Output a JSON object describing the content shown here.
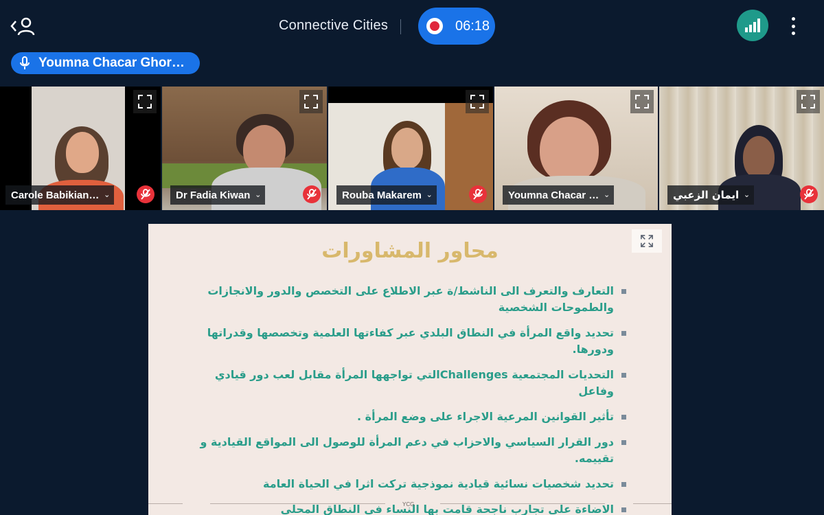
{
  "header": {
    "meeting_title": "Connective Cities",
    "recording_time": "06:18",
    "active_speaker": "Youmna Chacar Ghor…"
  },
  "participants": [
    {
      "name": "Carole Babikian…",
      "muted": true
    },
    {
      "name": "Dr Fadia Kiwan",
      "muted": true
    },
    {
      "name": "Rouba Makarem",
      "muted": true
    },
    {
      "name": "Youmna Chacar …",
      "muted": false,
      "active": true
    },
    {
      "name": "ايمان الزعبي",
      "muted": true
    }
  ],
  "slide": {
    "title": "محاور المشاورات",
    "bullets": [
      "التعارف والتعرف الى الناشط/ة عبر الاطلاع على التخصص والدور والانجازات والطموحات الشخصية",
      "تحديد واقع المرأة في النطاق البلدي عبر كفاءتها العلمية وتخصصها وقدراتها ودورها.",
      "التحديات المجتمعية Challengesالتي تواجهها المرأة مقابل لعب دور قيادي وفاعل",
      "تأثير القوانين المرعية الاجراء على وضع المرأة .",
      "دور القرار السياسي والاحزاب في دعم المرأة للوصول الى المواقع القيادية و تقييمه.",
      "تحديد شخصيات نسائية قيادية نموذجية تركت اثرا في الحياة العامة",
      "الاضاءة على تجارب ناجحة قامت بها النساء في النطاق المحلي"
    ],
    "footer": "YCG"
  },
  "colors": {
    "background": "#0b1a2e",
    "accent_blue": "#1a73e8",
    "signal_teal": "#1f9a8a",
    "mute_red": "#e8323a",
    "slide_title": "#d8b86c",
    "slide_text": "#2a9d8a"
  },
  "icons": [
    "back-participants-icon",
    "record-icon",
    "signal-icon",
    "more-icon",
    "microphone-icon",
    "expand-icon",
    "muted-mic-icon",
    "chevron-down-icon"
  ]
}
